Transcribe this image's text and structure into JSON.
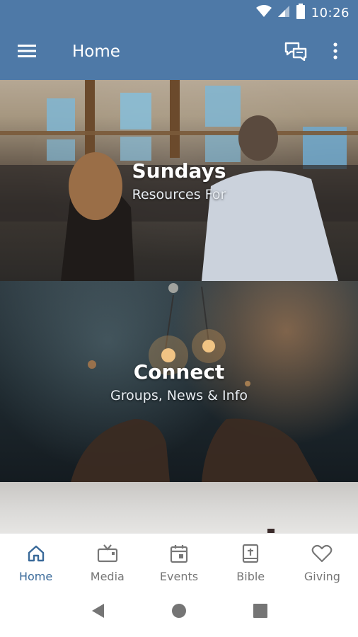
{
  "status_bar": {
    "time": "10:26"
  },
  "app_bar": {
    "title": "Home"
  },
  "cards": [
    {
      "title": "Sundays",
      "subtitle": "Resources For"
    },
    {
      "title": "Connect",
      "subtitle": "Groups, News & Info"
    }
  ],
  "bottom_nav": {
    "items": [
      {
        "label": "Home",
        "icon": "home-icon",
        "active": true
      },
      {
        "label": "Media",
        "icon": "tv-icon",
        "active": false
      },
      {
        "label": "Events",
        "icon": "calendar-icon",
        "active": false
      },
      {
        "label": "Bible",
        "icon": "bible-icon",
        "active": false
      },
      {
        "label": "Giving",
        "icon": "heart-icon",
        "active": false
      }
    ]
  },
  "colors": {
    "brand": "#4e79a7",
    "active_nav": "#3a6a9a",
    "inactive_nav": "#777777"
  }
}
